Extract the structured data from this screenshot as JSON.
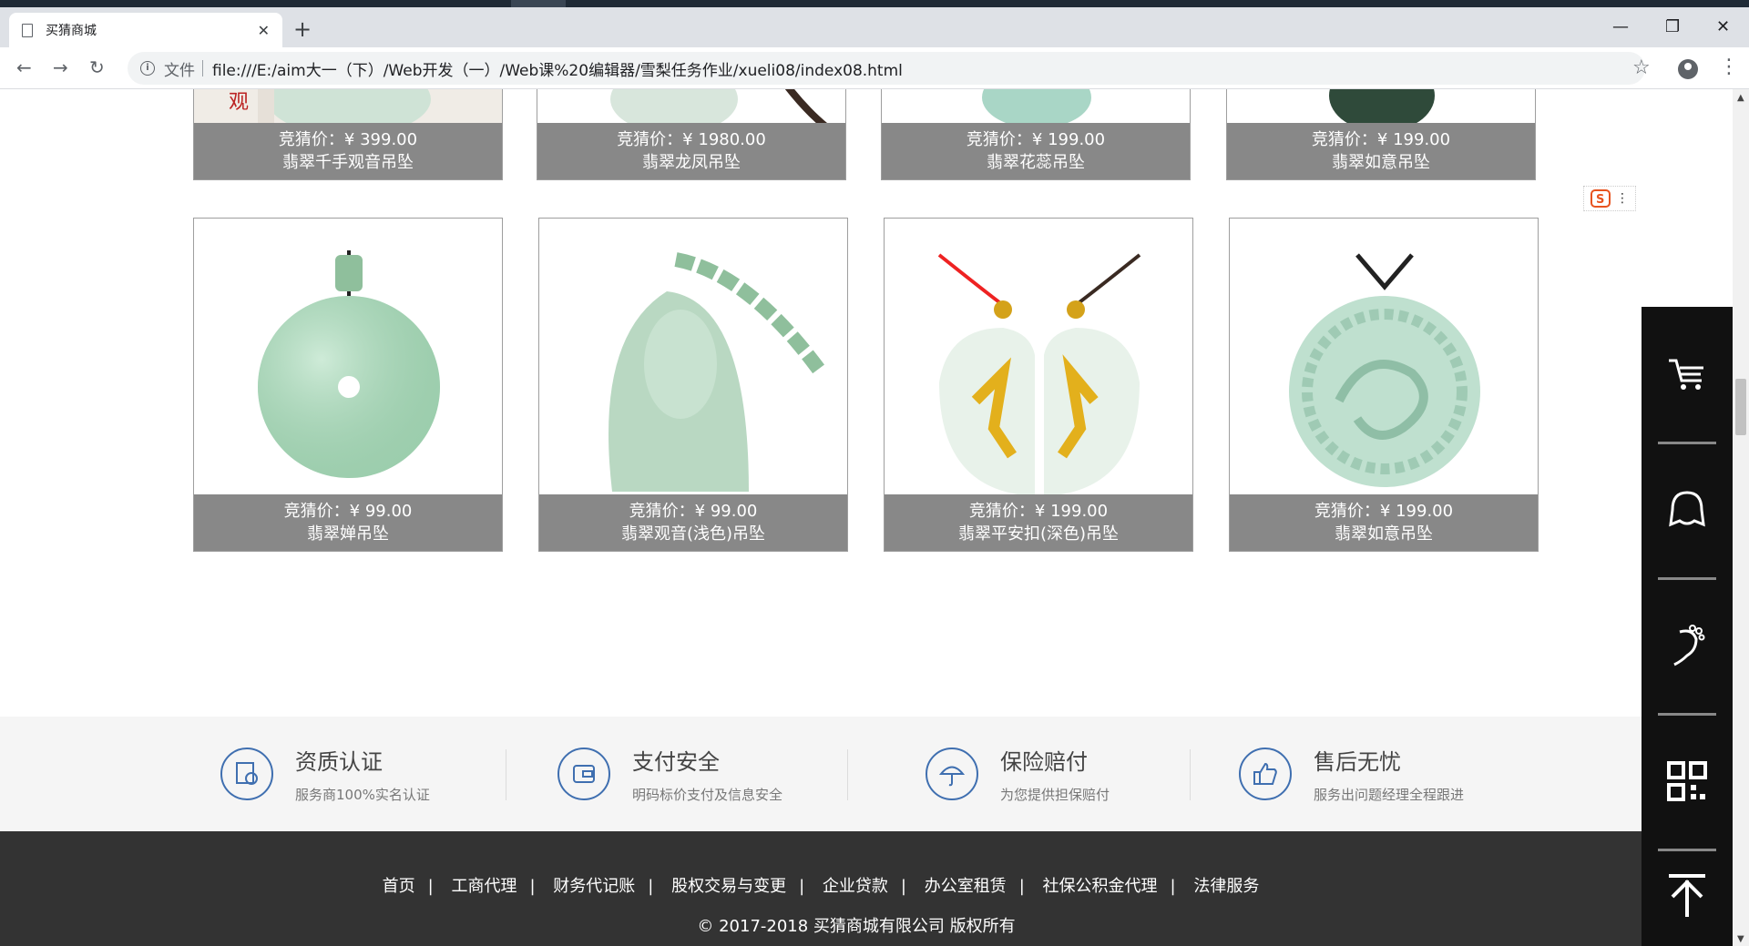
{
  "browser": {
    "tab_title": "买猜商城",
    "url_scheme": "文件",
    "url": "file:///E:/aim大一（下）/Web开发（一）/Web课%20编辑器/雪梨任务作业/xueli08/index08.html"
  },
  "products_top_row": [
    {
      "price": "竞猜价：¥  399.00",
      "name": "翡翠千手观音吊坠"
    },
    {
      "price": "竞猜价：¥  1980.00",
      "name": "翡翠龙凤吊坠"
    },
    {
      "price": "竞猜价：¥  199.00",
      "name": "翡翠花蕊吊坠"
    },
    {
      "price": "竞猜价：¥  199.00",
      "name": "翡翠如意吊坠"
    }
  ],
  "products_bottom_row": [
    {
      "price": "竞猜价：¥  99.00",
      "name": "翡翠婵吊坠"
    },
    {
      "price": "竞猜价：¥  99.00",
      "name": "翡翠观音(浅色)吊坠"
    },
    {
      "price": "竞猜价：¥  199.00",
      "name": "翡翠平安扣(深色)吊坠"
    },
    {
      "price": "竞猜价：¥  199.00",
      "name": "翡翠如意吊坠"
    }
  ],
  "features": [
    {
      "title": "资质认证",
      "desc": "服务商100%实名认证",
      "icon": "certificate-icon"
    },
    {
      "title": "支付安全",
      "desc": "明码标价支付及信息安全",
      "icon": "wallet-icon"
    },
    {
      "title": "保险赔付",
      "desc": "为您提供担保赔付",
      "icon": "umbrella-icon"
    },
    {
      "title": "售后无忧",
      "desc": "服务出问题经理全程跟进",
      "icon": "thumbs-up-icon"
    }
  ],
  "footer": {
    "links": [
      "首页",
      "工商代理",
      "财务代记账",
      "股权交易与变更",
      "企业贷款",
      "办公室租赁",
      "社保公积金代理",
      "法律服务"
    ],
    "copyright": "© 2017-2018 买猜商城有限公司 版权所有"
  },
  "sidebar_icons": [
    "cart-icon",
    "chat-bubble-icon",
    "footprint-icon",
    "qr-code-icon",
    "back-to-top-icon"
  ],
  "colors": {
    "caption_bg": "#888888",
    "footer_bg": "#333333",
    "sidebar_bg": "#111111",
    "feature_icon": "#3f6fb0"
  }
}
